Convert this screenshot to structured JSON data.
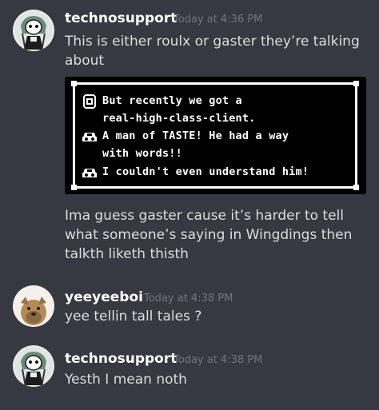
{
  "messages": [
    {
      "username": "technosupport",
      "timestamp": "Today at 4:36 PM",
      "lines": [
        "This is either roulx or gaster they’re talking about"
      ],
      "embed": {
        "dialog_lines": [
          "But recently we got a",
          "real-high-class-client.",
          "A man of TASTE! He had a way",
          "with words!!",
          "I couldn't even understand him!"
        ]
      },
      "after_lines": "Ima guess gaster cause it’s harder to tell what someone’s saying in Wingdings then talkth liketh thisth"
    },
    {
      "username": "yeeyeeboi",
      "timestamp": "Today at 4:38 PM",
      "lines": [
        "yee tellin tall tales ?"
      ]
    },
    {
      "username": "technosupport",
      "timestamp": "Today at 4:38 PM",
      "lines": [
        "Yesth I mean noth"
      ]
    }
  ],
  "colors": {
    "background": "#36393f",
    "username": "#ffffff",
    "timestamp": "#72767d",
    "message_text": "#dcddde"
  },
  "icons": {
    "dialog_icon_1": "phone-icon",
    "dialog_icon_2": "car-face-icon",
    "dialog_icon_3": "car-face-icon"
  }
}
